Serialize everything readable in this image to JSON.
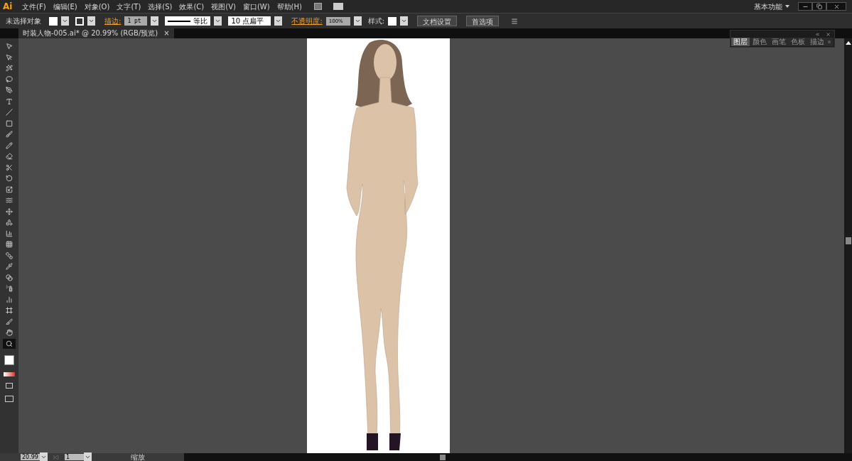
{
  "app": {
    "logo": "Ai",
    "workspace": "基本功能"
  },
  "menu": [
    "文件(F)",
    "编辑(E)",
    "对象(O)",
    "文字(T)",
    "选择(S)",
    "效果(C)",
    "视图(V)",
    "窗口(W)",
    "帮助(H)"
  ],
  "control_bar": {
    "selection": "未选择对象",
    "stroke_label": "描边:",
    "stroke_weight": "1 pt",
    "profile": "等比",
    "brush_size": "10",
    "brush": "点扁平",
    "opacity_label": "不透明度:",
    "opacity": "100%",
    "style_label": "样式:",
    "buttons": [
      "文档设置",
      "首选项"
    ]
  },
  "document_tab": {
    "title": "时装人物-005.ai* @ 20.99% (RGB/预览)",
    "close": "×"
  },
  "tools": [
    {
      "kind": "select",
      "selected": false
    },
    {
      "kind": "direct",
      "selected": false
    },
    {
      "kind": "wand",
      "selected": false
    },
    {
      "kind": "lasso",
      "selected": false
    },
    {
      "kind": "pen",
      "selected": false
    },
    {
      "kind": "type",
      "selected": false
    },
    {
      "kind": "line",
      "selected": false
    },
    {
      "kind": "rect",
      "selected": false
    },
    {
      "kind": "brush",
      "selected": false
    },
    {
      "kind": "pencil",
      "selected": false
    },
    {
      "kind": "eraser",
      "selected": false
    },
    {
      "kind": "scissors",
      "selected": false
    },
    {
      "kind": "rotate",
      "selected": false
    },
    {
      "kind": "scale",
      "selected": false
    },
    {
      "kind": "warp",
      "selected": false
    },
    {
      "kind": "transform",
      "selected": false
    },
    {
      "kind": "shape",
      "selected": false
    },
    {
      "kind": "graph",
      "selected": false
    },
    {
      "kind": "mesh",
      "selected": false
    },
    {
      "kind": "gradient",
      "selected": false
    },
    {
      "kind": "eyedropper",
      "selected": false
    },
    {
      "kind": "blend",
      "selected": false
    },
    {
      "kind": "spray",
      "selected": false
    },
    {
      "kind": "chart",
      "selected": false
    },
    {
      "kind": "artboard",
      "selected": false
    },
    {
      "kind": "slice",
      "selected": false
    },
    {
      "kind": "hand",
      "selected": false
    },
    {
      "kind": "zoom",
      "selected": true
    }
  ],
  "panel": {
    "tabs": [
      {
        "label": "图层",
        "selected": true
      },
      {
        "label": "颜色",
        "selected": false
      },
      {
        "label": "画笔",
        "selected": false
      },
      {
        "label": "色板",
        "selected": false
      },
      {
        "label": "描边",
        "selected": false
      }
    ]
  },
  "status_bar": {
    "zoom": "20.99",
    "artboard": "1",
    "tool": "缩放"
  }
}
